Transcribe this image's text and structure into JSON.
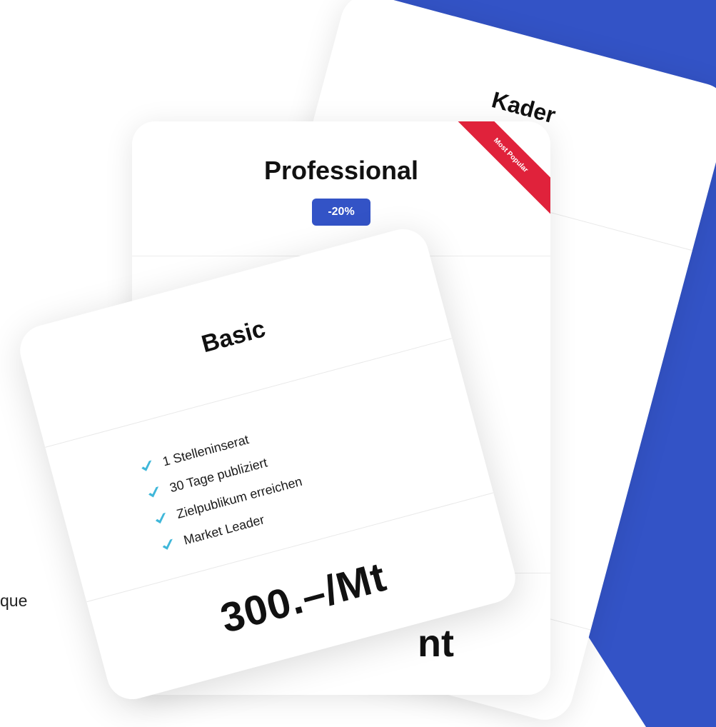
{
  "colors": {
    "accent_blue": "#3353c6",
    "ribbon_red": "#e0223b",
    "check_cyan": "#3fb7d9"
  },
  "left_fragment": {
    "text": "que"
  },
  "kader_card": {
    "title": "Kader"
  },
  "professional_card": {
    "title": "Professional",
    "discount_badge": "-20%",
    "ribbon_label": "Most Popular",
    "price_fragment": "nt"
  },
  "basic_card": {
    "title": "Basic",
    "features": [
      {
        "label": "1 Stelleninserat",
        "icon": "check-icon"
      },
      {
        "label": "30 Tage publiziert",
        "icon": "check-icon"
      },
      {
        "label": "Zielpublikum erreichen",
        "icon": "check-icon"
      },
      {
        "label": "Market Leader",
        "icon": "check-icon"
      }
    ],
    "price": "300.–/Mt"
  }
}
